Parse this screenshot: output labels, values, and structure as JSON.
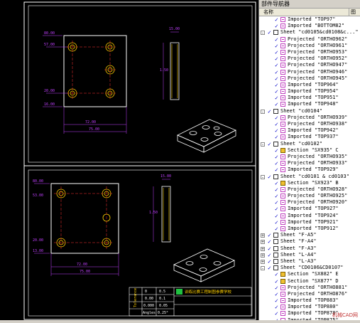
{
  "nav": {
    "title": "部件导航器",
    "col_name": "名称",
    "col_extra": "图",
    "items": [
      {
        "depth": 1,
        "exp": "",
        "type": "view",
        "label": "Imported \"TOP97\""
      },
      {
        "depth": 1,
        "exp": "",
        "type": "view",
        "label": "Imported \"BOTTOM82\""
      },
      {
        "depth": 0,
        "exp": "-",
        "type": "sheet",
        "label": "Sheet \"cd0105&cd0108&c...\""
      },
      {
        "depth": 1,
        "exp": "",
        "type": "view",
        "label": "Projected \"ORTHO962\""
      },
      {
        "depth": 1,
        "exp": "",
        "type": "view",
        "label": "Projected \"ORTHO961\""
      },
      {
        "depth": 1,
        "exp": "",
        "type": "view",
        "label": "Projected \"ORTHO953\""
      },
      {
        "depth": 1,
        "exp": "",
        "type": "view",
        "label": "Projected \"ORTHO952\""
      },
      {
        "depth": 1,
        "exp": "",
        "type": "view",
        "label": "Projected \"ORTHO947\""
      },
      {
        "depth": 1,
        "exp": "",
        "type": "view",
        "label": "Projected \"ORTHO946\""
      },
      {
        "depth": 1,
        "exp": "",
        "type": "view",
        "label": "Projected \"ORTHO945\""
      },
      {
        "depth": 1,
        "exp": "",
        "type": "view",
        "label": "Imported \"TOP964\""
      },
      {
        "depth": 1,
        "exp": "",
        "type": "view",
        "label": "Imported \"TOP954\""
      },
      {
        "depth": 1,
        "exp": "",
        "type": "view",
        "label": "Imported \"TOP951\""
      },
      {
        "depth": 1,
        "exp": "",
        "type": "view",
        "label": "Imported \"TOP948\""
      },
      {
        "depth": 0,
        "exp": "-",
        "type": "sheet",
        "label": "Sheet \"cd0104\""
      },
      {
        "depth": 1,
        "exp": "",
        "type": "view",
        "label": "Projected \"ORTHO939\""
      },
      {
        "depth": 1,
        "exp": "",
        "type": "view",
        "label": "Projected \"ORTHO938\""
      },
      {
        "depth": 1,
        "exp": "",
        "type": "view",
        "label": "Imported \"TOP942\""
      },
      {
        "depth": 1,
        "exp": "",
        "type": "view",
        "label": "Imported \"TOP937\""
      },
      {
        "depth": 0,
        "exp": "-",
        "type": "sheet",
        "label": "Sheet \"cd0102\""
      },
      {
        "depth": 1,
        "exp": "",
        "type": "section",
        "label": "Section \"SX935\" C"
      },
      {
        "depth": 1,
        "exp": "",
        "type": "view",
        "label": "Projected \"ORTHO935\""
      },
      {
        "depth": 1,
        "exp": "",
        "type": "view",
        "label": "Projected \"ORTHO933\""
      },
      {
        "depth": 1,
        "exp": "",
        "type": "view",
        "label": "Imported \"TOP929\""
      },
      {
        "depth": 0,
        "exp": "-",
        "type": "sheet",
        "label": "Sheet \"cd0101 & cd0103\""
      },
      {
        "depth": 1,
        "exp": "",
        "type": "section",
        "label": "Section \"SX923\" B"
      },
      {
        "depth": 1,
        "exp": "",
        "type": "view",
        "label": "Projected \"ORTHO928\""
      },
      {
        "depth": 1,
        "exp": "",
        "type": "view",
        "label": "Projected \"ORTHO925\""
      },
      {
        "depth": 1,
        "exp": "",
        "type": "view",
        "label": "Projected \"ORTHO920\""
      },
      {
        "depth": 1,
        "exp": "",
        "type": "view",
        "label": "Imported \"TOP927\""
      },
      {
        "depth": 1,
        "exp": "",
        "type": "view",
        "label": "Imported \"TOP924\""
      },
      {
        "depth": 1,
        "exp": "",
        "type": "view",
        "label": "Imported \"TOP921\""
      },
      {
        "depth": 1,
        "exp": "",
        "type": "view",
        "label": "Imported \"TOP912\""
      },
      {
        "depth": 0,
        "exp": "+",
        "type": "sheet",
        "label": "Sheet \"F-A5\""
      },
      {
        "depth": 0,
        "exp": "+",
        "type": "sheet",
        "label": "Sheet \"F-A4\""
      },
      {
        "depth": 0,
        "exp": "+",
        "type": "sheet",
        "label": "Sheet \"F-A3\""
      },
      {
        "depth": 0,
        "exp": "+",
        "type": "sheet",
        "label": "Sheet \"L-A4\""
      },
      {
        "depth": 0,
        "exp": "+",
        "type": "sheet",
        "label": "Sheet \"L-A3\""
      },
      {
        "depth": 0,
        "exp": "-",
        "type": "sheet",
        "label": "Sheet \"CD0106&CD0107\""
      },
      {
        "depth": 1,
        "exp": "",
        "type": "section",
        "label": "Section \"SX882\" E"
      },
      {
        "depth": 1,
        "exp": "",
        "type": "section",
        "label": "Section \"SX877\" D"
      },
      {
        "depth": 1,
        "exp": "",
        "type": "view",
        "label": "Projected \"ORTHO881\""
      },
      {
        "depth": 1,
        "exp": "",
        "type": "view",
        "label": "Projected \"ORTHO876\""
      },
      {
        "depth": 1,
        "exp": "",
        "type": "view",
        "label": "Imported \"TOP883\""
      },
      {
        "depth": 1,
        "exp": "",
        "type": "view",
        "label": "Imported \"TOP880\""
      },
      {
        "depth": 1,
        "exp": "",
        "type": "view",
        "label": "Imported \"TOP878\""
      },
      {
        "depth": 1,
        "exp": "",
        "type": "view",
        "label": "Imported \"TOP875\""
      }
    ],
    "watermark": "机械CAD网"
  },
  "drawing": {
    "title_block": {
      "company": "训练比赛工程制图参赛学校",
      "rows": [
        {
          "k": "0",
          "v": "0.5"
        },
        {
          "k": "0.00",
          "v": "0.1"
        },
        {
          "k": "0.000",
          "v": "0.05"
        },
        {
          "k": "Angles",
          "v": "0.25°"
        }
      ],
      "side_label": "Tolerance"
    },
    "dims_top": {
      "a": "80.00",
      "b": "57.00",
      "c": "20.00",
      "d": "16.00",
      "e": "72.00",
      "f": "75.00",
      "g": "1.50",
      "h": "15.00"
    },
    "dims_bot": {
      "a": "80.00",
      "b": "53.00",
      "c": "20.00",
      "d": "13.00",
      "e": "72.00",
      "f": "75.00",
      "g": "1.50",
      "h": "15.00"
    }
  },
  "colors": {
    "frame": "#ffffff",
    "part": "#ffffff",
    "dim": "#c040ff",
    "hole": "#ffd000",
    "center": "#ff3030",
    "view_border": "#20e040"
  }
}
